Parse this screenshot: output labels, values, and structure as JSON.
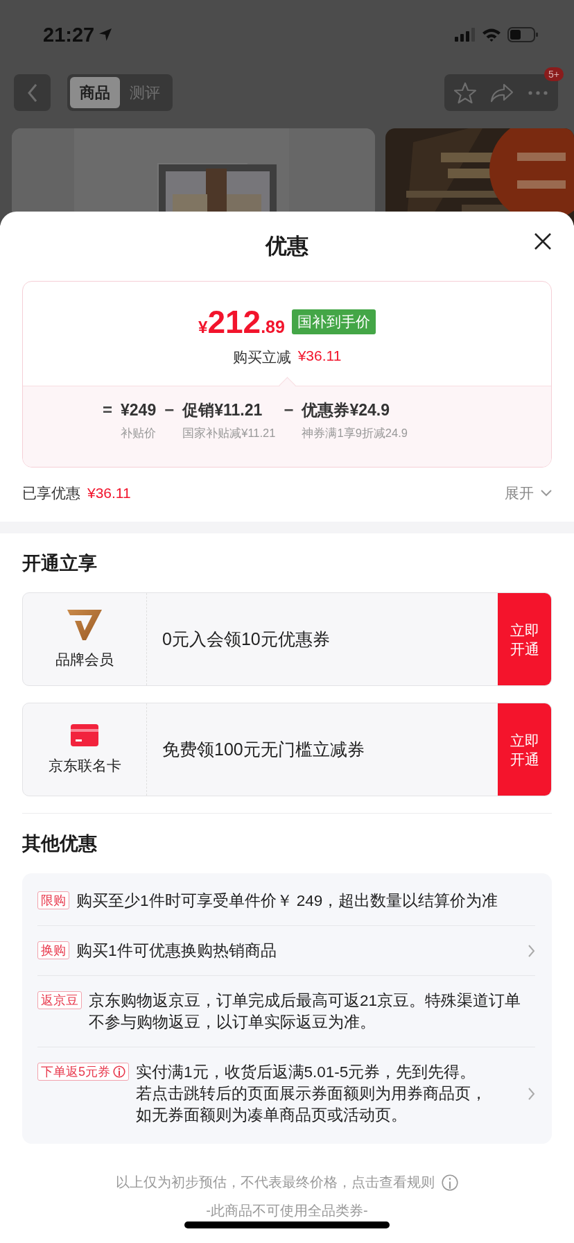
{
  "status_bar": {
    "time": "21:27"
  },
  "nav": {
    "tabs": [
      {
        "label": "商品",
        "selected": true
      },
      {
        "label": "测评",
        "selected": false
      }
    ],
    "badge": "5+"
  },
  "sheet": {
    "title": "优惠",
    "price": {
      "currency": "¥",
      "integer": "212",
      "decimal": ".89",
      "tag": "国补到手价",
      "saving_label": "购买立减",
      "saving_value": "¥36.11"
    },
    "breakdown": [
      {
        "operator": "=",
        "value": "¥249",
        "note": "补贴价"
      },
      {
        "operator": "−",
        "value": "促销¥11.21",
        "note": "国家补贴减¥11.21"
      },
      {
        "operator": "−",
        "value": "优惠券¥24.9",
        "note": "神券满1享9折减24.9"
      }
    ],
    "total": {
      "label": "已享优惠",
      "value": "¥36.11",
      "toggle": "展开"
    },
    "open_section": {
      "title": "开通立享",
      "cards": [
        {
          "kind": "brand_member",
          "name": "品牌会员",
          "offer": "0元入会领10元优惠券",
          "action": "立即开通"
        },
        {
          "kind": "co_card",
          "name": "京东联名卡",
          "offer": "免费领100元无门槛立减券",
          "action": "立即开通"
        }
      ]
    },
    "other_section": {
      "title": "其他优惠",
      "offers": [
        {
          "tag": "限购",
          "info": false,
          "text": "购买至少1件时可享受单件价￥ 249，超出数量以结算价为准",
          "link": false
        },
        {
          "tag": "换购",
          "info": false,
          "text": "购买1件可优惠换购热销商品",
          "link": true
        },
        {
          "tag": "返京豆",
          "info": false,
          "text": "京东购物返京豆，订单完成后最高可返21京豆。特殊渠道订单不参与购物返豆，以订单实际返豆为准。",
          "link": false
        },
        {
          "tag": "下单返5元券",
          "info": true,
          "text": "实付满1元，收货后返满5.01-5元券，先到先得。若点击跳转后的页面展示券面额则为用券商品页，如无券面额则为凑单商品页或活动页。",
          "link": true
        }
      ]
    },
    "footer": {
      "note": "以上仅为初步预估，不代表最终价格，点击查看规则",
      "notice": "-此商品不可使用全品类券-"
    }
  }
}
